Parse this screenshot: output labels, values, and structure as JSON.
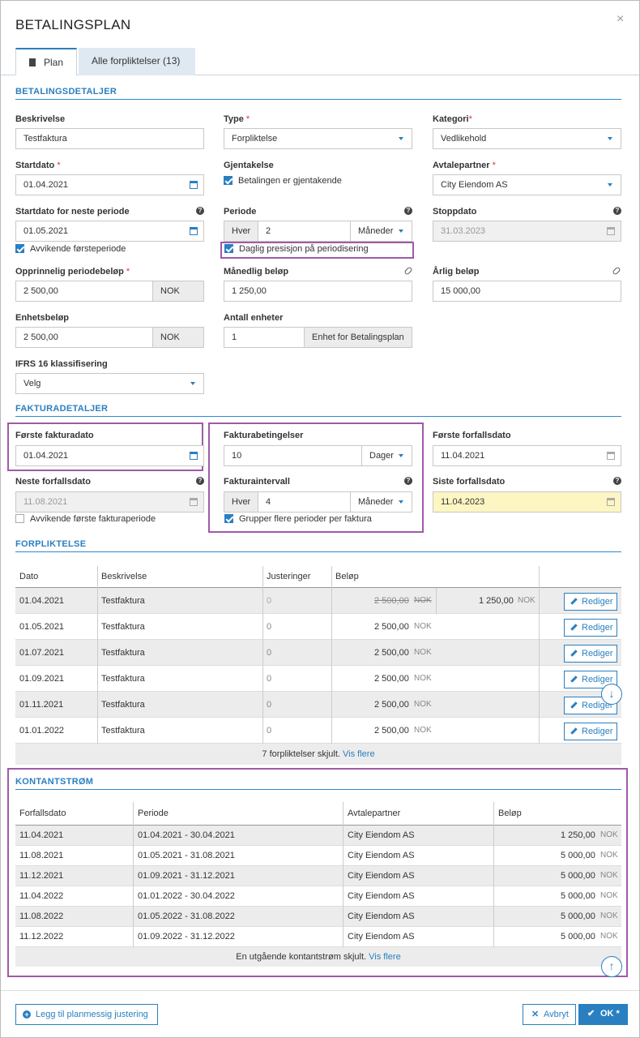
{
  "dialog": {
    "title": "BETALINGSPLAN",
    "close": "×"
  },
  "tabs": [
    {
      "label": "Plan"
    },
    {
      "label": "Alle forpliktelser (13)"
    }
  ],
  "sections": {
    "betaling": "BETALINGSDETALJER",
    "faktura": "FAKTURADETALJER",
    "forpliktelse": "FORPLIKTELSE",
    "kontant": "KONTANTSTRØM"
  },
  "fields": {
    "beskrivelse": {
      "label": "Beskrivelse",
      "value": "Testfaktura"
    },
    "type": {
      "label": "Type",
      "value": "Forpliktelse"
    },
    "kategori": {
      "label": "Kategori",
      "value": "Vedlikehold"
    },
    "startdato": {
      "label": "Startdato",
      "value": "01.04.2021"
    },
    "gjentakelse": {
      "label": "Gjentakelse",
      "checkbox": "Betalingen er gjentakende"
    },
    "avtalepartner": {
      "label": "Avtalepartner",
      "value": "City Eiendom AS"
    },
    "startneste": {
      "label": "Startdato for neste periode",
      "value": "01.05.2021",
      "checkbox": "Avvikende førsteperiode"
    },
    "periode": {
      "label": "Periode",
      "prefix": "Hver",
      "value": "2",
      "unit": "Måneder",
      "checkbox": "Daglig presisjon på periodisering"
    },
    "stoppdato": {
      "label": "Stoppdato",
      "value": "31.03.2023"
    },
    "opprinnelig": {
      "label": "Opprinnelig periodebeløp",
      "value": "2 500,00",
      "unit": "NOK"
    },
    "manedlig": {
      "label": "Månedlig beløp",
      "value": "1 250,00"
    },
    "arlig": {
      "label": "Årlig beløp",
      "value": "15 000,00"
    },
    "enhetsbelop": {
      "label": "Enhetsbeløp",
      "value": "2 500,00",
      "unit": "NOK"
    },
    "antall": {
      "label": "Antall enheter",
      "value": "1",
      "unit": "Enhet for Betalingsplan"
    },
    "ifrs": {
      "label": "IFRS 16 klassifisering",
      "value": "Velg"
    },
    "forstefaktura": {
      "label": "Første fakturadato",
      "value": "01.04.2021"
    },
    "fakturabet": {
      "label": "Fakturabetingelser",
      "value": "10",
      "unit": "Dager"
    },
    "forsteforfall": {
      "label": "Første forfallsdato",
      "value": "11.04.2021"
    },
    "nesteforfall": {
      "label": "Neste forfallsdato",
      "value": "11.08.2021",
      "checkbox": "Avvikende første fakturaperiode"
    },
    "fakturaint": {
      "label": "Fakturaintervall",
      "prefix": "Hver",
      "value": "4",
      "unit": "Måneder",
      "checkbox": "Grupper flere perioder per faktura"
    },
    "sisteforfall": {
      "label": "Siste forfallsdato",
      "value": "11.04.2023"
    }
  },
  "forpliktelse": {
    "headers": [
      "Dato",
      "Beskrivelse",
      "Justeringer",
      "Beløp"
    ],
    "rows": [
      {
        "dato": "01.04.2021",
        "beskrivelse": "Testfaktura",
        "just": "0",
        "belop": "2 500,00",
        "cur": "NOK",
        "adjusted": "1 250,00",
        "cur2": "NOK",
        "action": "Rediger"
      },
      {
        "dato": "01.05.2021",
        "beskrivelse": "Testfaktura",
        "just": "0",
        "belop": "2 500,00",
        "cur": "NOK",
        "action": "Rediger"
      },
      {
        "dato": "01.07.2021",
        "beskrivelse": "Testfaktura",
        "just": "0",
        "belop": "2 500,00",
        "cur": "NOK",
        "action": "Rediger"
      },
      {
        "dato": "01.09.2021",
        "beskrivelse": "Testfaktura",
        "just": "0",
        "belop": "2 500,00",
        "cur": "NOK",
        "action": "Rediger"
      },
      {
        "dato": "01.11.2021",
        "beskrivelse": "Testfaktura",
        "just": "0",
        "belop": "2 500,00",
        "cur": "NOK",
        "action": "Rediger"
      },
      {
        "dato": "01.01.2022",
        "beskrivelse": "Testfaktura",
        "just": "0",
        "belop": "2 500,00",
        "cur": "NOK",
        "action": "Rediger"
      }
    ],
    "hidden_text": "7 forpliktelser skjult.",
    "more": "Vis flere"
  },
  "kontant": {
    "headers": [
      "Forfallsdato",
      "Periode",
      "Avtalepartner",
      "Beløp"
    ],
    "rows": [
      {
        "forfall": "11.04.2021",
        "periode": "01.04.2021 - 30.04.2021",
        "partner": "City Eiendom AS",
        "belop": "1 250,00",
        "cur": "NOK"
      },
      {
        "forfall": "11.08.2021",
        "periode": "01.05.2021 - 31.08.2021",
        "partner": "City Eiendom AS",
        "belop": "5 000,00",
        "cur": "NOK"
      },
      {
        "forfall": "11.12.2021",
        "periode": "01.09.2021 - 31.12.2021",
        "partner": "City Eiendom AS",
        "belop": "5 000,00",
        "cur": "NOK"
      },
      {
        "forfall": "11.04.2022",
        "periode": "01.01.2022 - 30.04.2022",
        "partner": "City Eiendom AS",
        "belop": "5 000,00",
        "cur": "NOK"
      },
      {
        "forfall": "11.08.2022",
        "periode": "01.05.2022 - 31.08.2022",
        "partner": "City Eiendom AS",
        "belop": "5 000,00",
        "cur": "NOK"
      },
      {
        "forfall": "11.12.2022",
        "periode": "01.09.2022 - 31.12.2022",
        "partner": "City Eiendom AS",
        "belop": "5 000,00",
        "cur": "NOK"
      }
    ],
    "hidden_text": "En utgående kontantstrøm skjult.",
    "more": "Vis flere"
  },
  "footer": {
    "add": "Legg til planmessig justering",
    "cancel": "Avbryt",
    "ok": "OK *"
  },
  "colors": {
    "accent": "#2a7fc0",
    "highlight": "#a05aa8",
    "yellow": "#fdf6c3"
  }
}
